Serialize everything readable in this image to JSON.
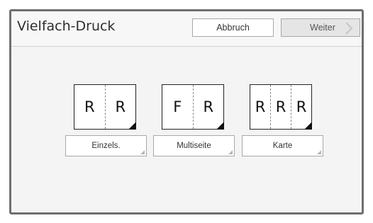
{
  "header": {
    "title": "Vielfach-Druck",
    "cancel_label": "Abbruch",
    "next_label": "Weiter"
  },
  "options": [
    {
      "label": "Einzels.",
      "letters": [
        "R",
        "R"
      ]
    },
    {
      "label": "Multiseite",
      "letters": [
        "F",
        "R"
      ]
    },
    {
      "label": "Karte",
      "letters": [
        "R",
        "R",
        "R"
      ]
    }
  ],
  "colors": {
    "frame_border": "#6f6f6f",
    "panel_background": "#f4f4f4",
    "next_button_background": "#e5e5e5"
  },
  "icons": {
    "next": "chevron-right-icon",
    "page_fold": "page-fold-corner"
  }
}
